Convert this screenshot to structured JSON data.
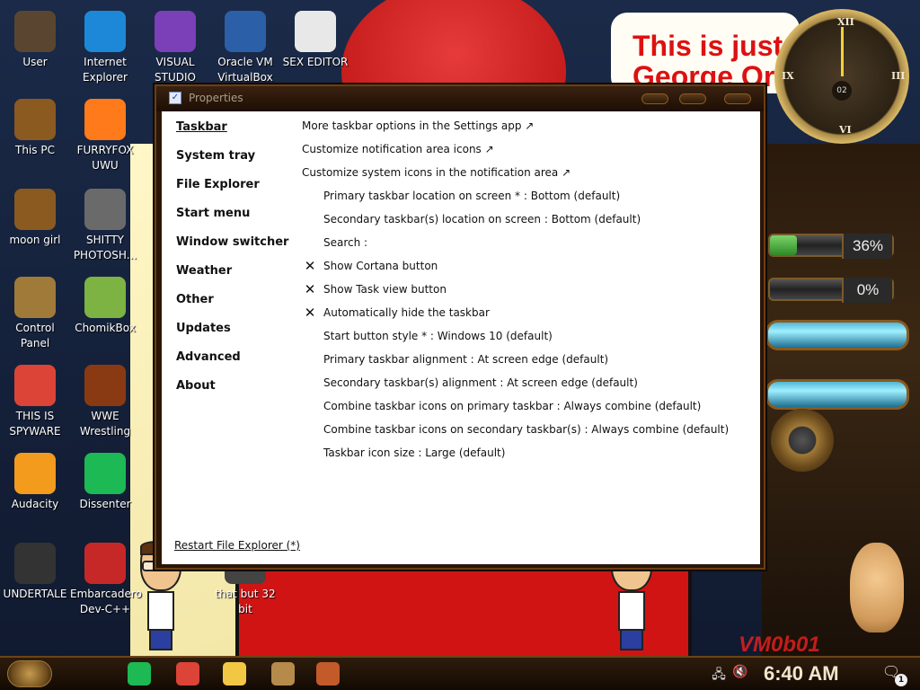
{
  "wallpaper": {
    "banner_text_line1": "This is just",
    "banner_text_line2": "George Orwell",
    "vm_text": "VM0b01",
    "clock_center": "02",
    "gauge_top": {
      "percent_label": "36%",
      "fill_fraction": 0.36
    },
    "gauge_bottom": {
      "percent_label": "0%",
      "fill_fraction": 0.0
    }
  },
  "desktop_icons": [
    {
      "label": "User",
      "icon": "user-icon",
      "color": "#5a4630"
    },
    {
      "label": "Internet Explorer",
      "icon": "edge-icon",
      "color": "#1e88d8"
    },
    {
      "label": "VISUAL STUDIO",
      "icon": "visual-studio-icon",
      "color": "#7b3fb8"
    },
    {
      "label": "Oracle VM VirtualBox",
      "icon": "virtualbox-icon",
      "color": "#2b5fa8"
    },
    {
      "label": "SEX EDITOR",
      "icon": "hex-editor-icon",
      "color": "#e8e8e8"
    },
    {
      "label": "This PC",
      "icon": "this-pc-icon",
      "color": "#8a5a20"
    },
    {
      "label": "FURRYFOX UWU",
      "icon": "firefox-icon",
      "color": "#ff7a1a"
    },
    {
      "label": "moon girl",
      "icon": "moon-girl-icon",
      "color": "#8a5a20"
    },
    {
      "label": "SHITTY PHOTOSH...",
      "icon": "gimp-icon",
      "color": "#6a6a6a"
    },
    {
      "label": "Control Panel",
      "icon": "control-panel-icon",
      "color": "#a07a38"
    },
    {
      "label": "ChomikBox",
      "icon": "chomikbox-icon",
      "color": "#7cb342"
    },
    {
      "label": "THIS IS SPYWARE",
      "icon": "chrome-icon",
      "color": "#db4437"
    },
    {
      "label": "WWE Wrestling",
      "icon": "wwe-icon",
      "color": "#8a3a12"
    },
    {
      "label": "Audacity",
      "icon": "audacity-icon",
      "color": "#f29b1c"
    },
    {
      "label": "Dissenter",
      "icon": "spotify-like-icon",
      "color": "#1db954"
    },
    {
      "label": "UNDERTALE",
      "icon": "unity-icon",
      "color": "#333333"
    },
    {
      "label": "Embarcadero Dev-C++",
      "icon": "devcpp-icon",
      "color": "#c62828"
    },
    {
      "label": "that but 32 bit",
      "icon": "app-icon",
      "color": "#444444"
    }
  ],
  "window": {
    "title": "Properties",
    "nav": [
      {
        "label": "Taskbar",
        "active": true
      },
      {
        "label": "System tray",
        "active": false
      },
      {
        "label": "File Explorer",
        "active": false
      },
      {
        "label": "Start menu",
        "active": false
      },
      {
        "label": "Window switcher",
        "active": false
      },
      {
        "label": "Weather",
        "active": false
      },
      {
        "label": "Other",
        "active": false
      },
      {
        "label": "Updates",
        "active": false
      },
      {
        "label": "Advanced",
        "active": false
      },
      {
        "label": "About",
        "active": false
      }
    ],
    "options": [
      {
        "text": "More taskbar options in the Settings app ↗",
        "indent": false,
        "checked": false
      },
      {
        "text": "Customize notification area icons ↗",
        "indent": false,
        "checked": false
      },
      {
        "text": "Customize system icons in the notification area ↗",
        "indent": false,
        "checked": false
      },
      {
        "text": "Primary taskbar location on screen * : Bottom (default)",
        "indent": true,
        "checked": false
      },
      {
        "text": "Secondary taskbar(s) location on screen : Bottom (default)",
        "indent": true,
        "checked": false
      },
      {
        "text": "Search :",
        "indent": true,
        "checked": false
      },
      {
        "text": "Show Cortana button",
        "indent": true,
        "checked": true
      },
      {
        "text": "Show Task view button",
        "indent": true,
        "checked": true
      },
      {
        "text": "Automatically hide the taskbar",
        "indent": true,
        "checked": true
      },
      {
        "text": "Start button style * : Windows 10 (default)",
        "indent": true,
        "checked": false
      },
      {
        "text": "Primary taskbar alignment : At screen edge (default)",
        "indent": true,
        "checked": false
      },
      {
        "text": "Secondary taskbar(s) alignment : At screen edge (default)",
        "indent": true,
        "checked": false
      },
      {
        "text": "Combine taskbar icons on primary taskbar : Always combine (default)",
        "indent": true,
        "checked": false
      },
      {
        "text": "Combine taskbar icons on secondary taskbar(s) : Always combine (default)",
        "indent": true,
        "checked": false
      },
      {
        "text": "Taskbar icon size : Large (default)",
        "indent": true,
        "checked": false
      }
    ],
    "restart_link": "Restart File Explorer (*)",
    "check_glyph": "✕"
  },
  "taskbar": {
    "pinned": [
      {
        "name": "dissenter-taskbar-icon",
        "color": "#1db954"
      },
      {
        "name": "chrome-taskbar-icon",
        "color": "#db4437"
      },
      {
        "name": "file-explorer-taskbar-icon",
        "color": "#f2c744"
      },
      {
        "name": "chomikbox-taskbar-icon",
        "color": "#b58a4a"
      },
      {
        "name": "doc-taskbar-icon",
        "color": "#c25a2a"
      }
    ],
    "clock": "6:40 AM",
    "notification_count": "1"
  }
}
